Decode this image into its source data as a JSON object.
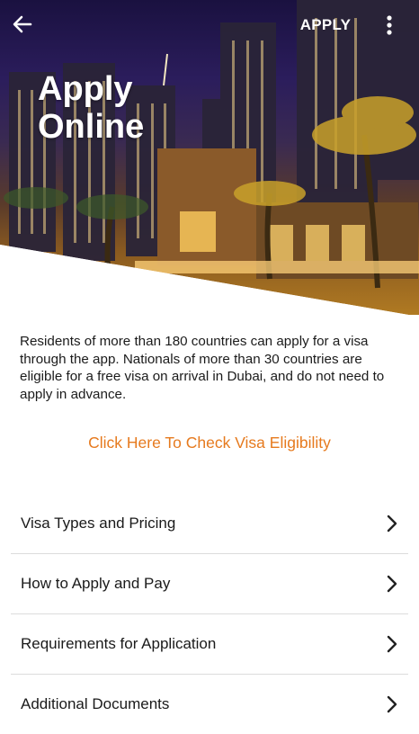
{
  "topbar": {
    "back_icon": "arrow-left-icon",
    "action_label": "APPLY",
    "more_icon": "more-vertical-icon"
  },
  "hero": {
    "title_line1": "Apply",
    "title_line2": "Online"
  },
  "intro": {
    "text": "Residents of more than 180 countries can apply for a visa through the app. Nationals of more than 30 countries are eligible for a free visa on arrival in Dubai, and do not need to apply in advance."
  },
  "eligibility": {
    "link_label": "Click Here To Check Visa Eligibility"
  },
  "menu": {
    "items": [
      {
        "label": "Visa Types and Pricing"
      },
      {
        "label": "How to Apply and Pay"
      },
      {
        "label": "Requirements for Application"
      },
      {
        "label": "Additional Documents"
      }
    ],
    "chevron_icon": "chevron-right-icon"
  },
  "colors": {
    "accent": "#e67a1e",
    "text": "#1b1b1b",
    "divider": "#dcdcdc"
  }
}
